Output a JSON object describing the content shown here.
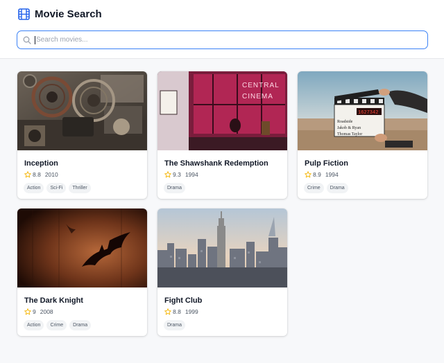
{
  "header": {
    "title": "Movie Search"
  },
  "search": {
    "placeholder": "Search movies...",
    "value": ""
  },
  "colors": {
    "accent": "#3b82f6",
    "star": "#f5b400"
  },
  "movies": [
    {
      "title": "Inception",
      "rating": "8.8",
      "year": "2010",
      "tags": [
        "Action",
        "Sci-Fi",
        "Thriller"
      ]
    },
    {
      "title": "The Shawshank Redemption",
      "rating": "9.3",
      "year": "1994",
      "tags": [
        "Drama"
      ]
    },
    {
      "title": "Pulp Fiction",
      "rating": "8.9",
      "year": "1994",
      "tags": [
        "Crime",
        "Drama"
      ]
    },
    {
      "title": "The Dark Knight",
      "rating": "9",
      "year": "2008",
      "tags": [
        "Action",
        "Crime",
        "Drama"
      ]
    },
    {
      "title": "Fight Club",
      "rating": "8.8",
      "year": "1999",
      "tags": [
        "Drama"
      ]
    }
  ],
  "poster_signs": {
    "cinema": [
      "CENTRAL",
      "CINEMA"
    ],
    "clapboard": [
      "Roadside",
      "Jakob & Ryan",
      "Thomas Taylor"
    ]
  }
}
